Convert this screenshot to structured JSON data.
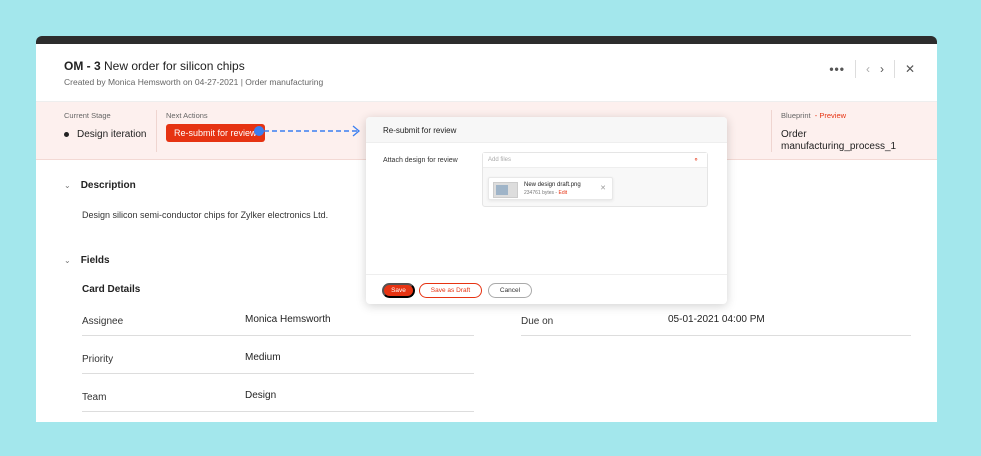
{
  "header": {
    "id": "OM - 3",
    "title": "New order for silicon chips",
    "subtitle": "Created by  Monica Hemsworth  on 04-27-2021  |  Order manufacturing",
    "icons": {
      "more": "more-icon",
      "prev": "chevron-left-icon",
      "next": "chevron-right-icon",
      "close": "close-icon"
    }
  },
  "stagebar": {
    "current_stage_label": "Current Stage",
    "current_stage": "Design iteration",
    "next_actions_label": "Next Actions",
    "next_action_button": "Re-submit for review",
    "blueprint_label": "Blueprint",
    "blueprint_preview": "- Preview",
    "blueprint_value": "Order manufacturing_process_1"
  },
  "description": {
    "heading": "Description",
    "text": "Design silicon semi-conductor chips for Zylker electronics Ltd."
  },
  "fields": {
    "heading": "Fields",
    "card_title": "Card Details",
    "rows": [
      {
        "label": "Assignee",
        "value": "Monica Hemsworth"
      },
      {
        "label": "Priority",
        "value": "Medium"
      },
      {
        "label": "Team",
        "value": "Design"
      }
    ],
    "due": {
      "label": "Due on",
      "value": "05-01-2021 04:00 PM"
    }
  },
  "modal": {
    "title": "Re-submit for review",
    "attach_label": "Attach design for review",
    "attach_placeholder": "Add files",
    "file_name": "New design draft.png",
    "file_size": "234761 bytes",
    "file_edit": "Edit",
    "save": "Save",
    "save_draft": "Save as Draft",
    "cancel": "Cancel"
  },
  "colors": {
    "accent": "#e63312",
    "stage_bg": "#fdf0ee",
    "page_bg": "#a3e7ec",
    "arrow": "#3b7ff0"
  }
}
